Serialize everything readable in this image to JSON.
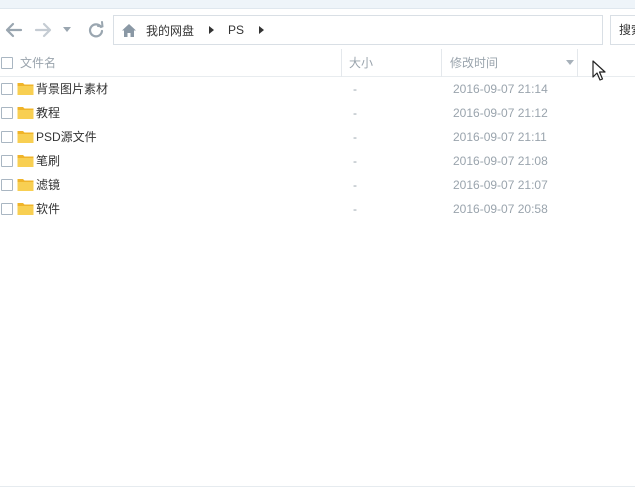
{
  "toolbar": {
    "breadcrumb": [
      {
        "label": "我的网盘"
      },
      {
        "label": "PS"
      }
    ],
    "search_label": "搜索"
  },
  "columns": {
    "name": "文件名",
    "size": "大小",
    "modified": "修改时间"
  },
  "files": [
    {
      "name": "背景图片素材",
      "size": "-",
      "modified": "2016-09-07 21:14"
    },
    {
      "name": "教程",
      "size": "-",
      "modified": "2016-09-07 21:12"
    },
    {
      "name": "PSD源文件",
      "size": "-",
      "modified": "2016-09-07 21:11"
    },
    {
      "name": "笔刷",
      "size": "-",
      "modified": "2016-09-07 21:08"
    },
    {
      "name": "滤镜",
      "size": "-",
      "modified": "2016-09-07 21:07"
    },
    {
      "name": "软件",
      "size": "-",
      "modified": "2016-09-07 20:58"
    }
  ],
  "colors": {
    "accent_icon": "#9aa6b0",
    "folder": "#f5c33b",
    "header_text": "#9aa4ad"
  }
}
